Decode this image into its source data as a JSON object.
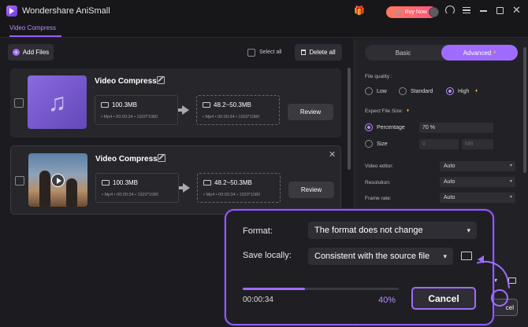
{
  "app": {
    "title": "Wondershare AniSmall",
    "buy_label": "Buy Now"
  },
  "tabs": [
    {
      "label": "Video Compress"
    }
  ],
  "toolbar": {
    "add_files": "Add Files",
    "select_all": "Select all",
    "delete_all": "Delete all"
  },
  "files": [
    {
      "title": "Video Compress",
      "src_size": "100.3MB",
      "src_meta": "• Mp4   • 00:00:34   • 1920*1080",
      "dst_size": "48.2~50.3MB",
      "dst_meta": "• Mp4   • 00:00:34   • 1920*1080",
      "review": "Review"
    },
    {
      "title": "Video Compress",
      "src_size": "100.3MB",
      "src_meta": "• Mp4   • 00:00:34   • 1920*1080",
      "dst_size": "48.2~50.3MB",
      "dst_meta": "• Mp4   • 00:00:34   • 1920*1080",
      "review": "Review"
    }
  ],
  "panel": {
    "basic": "Basic",
    "advanced": "Advanced",
    "file_quality": "File quality :",
    "quality_options": [
      "Low",
      "Standard",
      "High"
    ],
    "quality_selected": "High",
    "expect_size": "Expect File Size:",
    "percentage_label": "Percentage",
    "percentage_value": "70 %",
    "size_label": "Size",
    "size_value": "0",
    "size_unit": "MB",
    "video_editor_label": "Video editor:",
    "video_editor_value": "Auto",
    "resolution_label": "Resolution:",
    "resolution_value": "Auto",
    "frame_rate_label": "Frame rate:",
    "frame_rate_value": "Auto"
  },
  "overlay": {
    "format_label": "Format:",
    "format_value": "The format does not change",
    "save_label": "Save locally:",
    "save_value": "Consistent with the source file",
    "time": "00:00:34",
    "percent": "40%",
    "progress": 0.4,
    "cancel": "Cancel"
  },
  "peek": {
    "cancel_label": "cel"
  },
  "colors": {
    "accent": "#a06cff",
    "buy_gradient_start": "#ff7a5e",
    "buy_gradient_end": "#ff5580"
  }
}
